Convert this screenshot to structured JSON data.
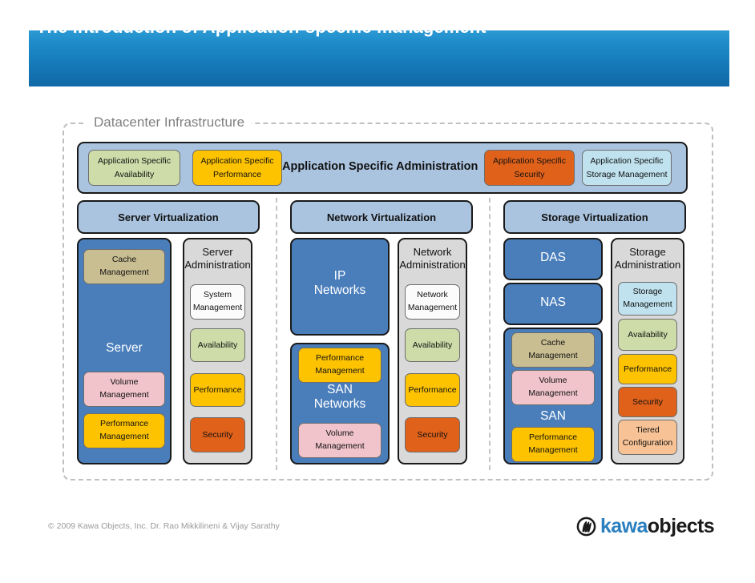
{
  "slide": {
    "title": "The introduction of Application-specific management",
    "frame_label": "Datacenter Infrastructure",
    "copyright": "© 2009  Kawa Objects, Inc. Dr. Rao Mikkilineni & Vijay Sarathy",
    "logo": {
      "part1": "kawa",
      "part2": "objects",
      "mark": "kawa-logo-mark-icon"
    }
  },
  "colors": {
    "title_bar_top": "#2e9ad4",
    "title_bar_bottom": "#1268a6",
    "panel_blue": "#aac4e0",
    "resource_blue": "#4a7ebb",
    "admin_grey": "#d9d9d9",
    "green": "#cddca9",
    "gold": "#fdc300",
    "orange": "#e0611a",
    "lightblue": "#bfe2ee",
    "khaki": "#c9be92",
    "pink": "#f0c4ca",
    "white": "#fbfbfb",
    "peach": "#f7c396",
    "frame_dash": "#bfbfbf"
  },
  "admin_bar": {
    "title": "Application Specific Administration",
    "chips": [
      {
        "line1": "Application Specific",
        "line2": "Availability",
        "color": "#cddca9"
      },
      {
        "line1": "Application Specific",
        "line2": "Performance",
        "color": "#fdc300"
      },
      {
        "line1": "Application Specific",
        "line2": "Security",
        "color": "#e0611a"
      },
      {
        "line1": "Application Specific",
        "line2": "Storage Management",
        "color": "#bfe2ee"
      }
    ]
  },
  "columns": [
    {
      "header": "Server Virtualization",
      "resources": [
        {
          "label": "Server",
          "chips": [
            {
              "line1": "Cache",
              "line2": "Management",
              "color": "#c9be92"
            },
            {
              "line1": "Volume",
              "line2": "Management",
              "color": "#f0c4ca"
            },
            {
              "line1": "Performance",
              "line2": "Management",
              "color": "#fdc300"
            }
          ]
        }
      ],
      "admin": {
        "title_line1": "Server",
        "title_line2": "Administration",
        "chips": [
          {
            "line1": "System",
            "line2": "Management",
            "color": "#fbfbfb"
          },
          {
            "line1": "Availability",
            "line2": "",
            "color": "#cddca9"
          },
          {
            "line1": "Performance",
            "line2": "",
            "color": "#fdc300"
          },
          {
            "line1": "Security",
            "line2": "",
            "color": "#e0611a"
          }
        ]
      }
    },
    {
      "header": "Network Virtualization",
      "resources": [
        {
          "label": "IP\nNetworks",
          "chips": []
        },
        {
          "label": "SAN\nNetworks",
          "chips": [
            {
              "line1": "Performance",
              "line2": "Management",
              "color": "#fdc300"
            },
            {
              "line1": "Volume",
              "line2": "Management",
              "color": "#f0c4ca"
            }
          ]
        }
      ],
      "admin": {
        "title_line1": "Network",
        "title_line2": "Administration",
        "chips": [
          {
            "line1": "Network",
            "line2": "Management",
            "color": "#fbfbfb"
          },
          {
            "line1": "Availability",
            "line2": "",
            "color": "#cddca9"
          },
          {
            "line1": "Performance",
            "line2": "",
            "color": "#fdc300"
          },
          {
            "line1": "Security",
            "line2": "",
            "color": "#e0611a"
          }
        ]
      }
    },
    {
      "header": "Storage Virtualization",
      "resources": [
        {
          "label": "DAS",
          "chips": []
        },
        {
          "label": "NAS",
          "chips": []
        },
        {
          "label": "SAN",
          "chips": [
            {
              "line1": "Cache",
              "line2": "Management",
              "color": "#c9be92"
            },
            {
              "line1": "Volume",
              "line2": "Management",
              "color": "#f0c4ca"
            },
            {
              "line1": "Performance",
              "line2": "Management",
              "color": "#fdc300"
            }
          ]
        }
      ],
      "admin": {
        "title_line1": "Storage",
        "title_line2": "Administration",
        "chips": [
          {
            "line1": "Storage",
            "line2": "Management",
            "color": "#bfe2ee"
          },
          {
            "line1": "Availability",
            "line2": "",
            "color": "#cddca9"
          },
          {
            "line1": "Performance",
            "line2": "",
            "color": "#fdc300"
          },
          {
            "line1": "Security",
            "line2": "",
            "color": "#e0611a"
          },
          {
            "line1": "Tiered",
            "line2": "Configuration",
            "color": "#f7c396"
          }
        ]
      }
    }
  ]
}
